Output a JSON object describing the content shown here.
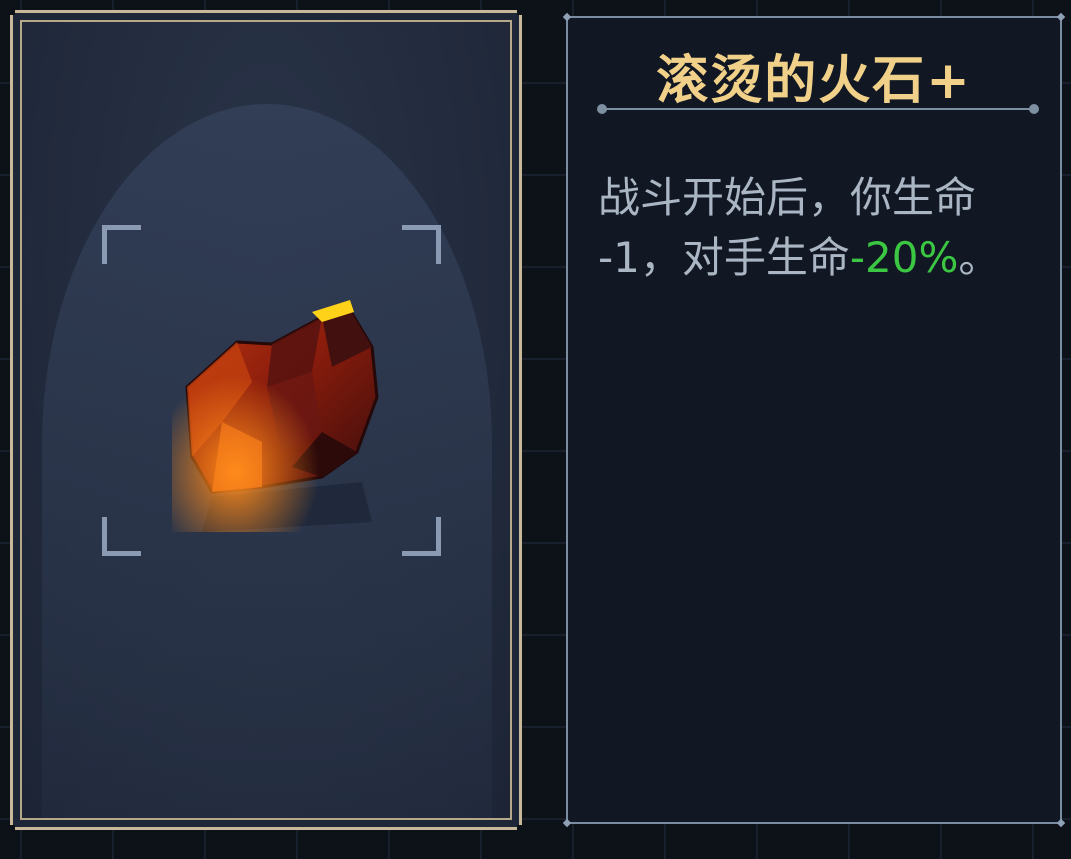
{
  "item": {
    "name": "滚烫的火石+",
    "icon": "flint-stone-icon",
    "description": {
      "line1": "战斗开始后，你生命",
      "line2_prefix": "-1，对手生命",
      "line2_value": "-20%",
      "line2_suffix": "。"
    }
  },
  "colors": {
    "title": "#f1d189",
    "description": "#aab6c4",
    "value_highlight": "#3cc743",
    "card_border": "#c8b99a",
    "panel_border": "#7a8ca0"
  }
}
